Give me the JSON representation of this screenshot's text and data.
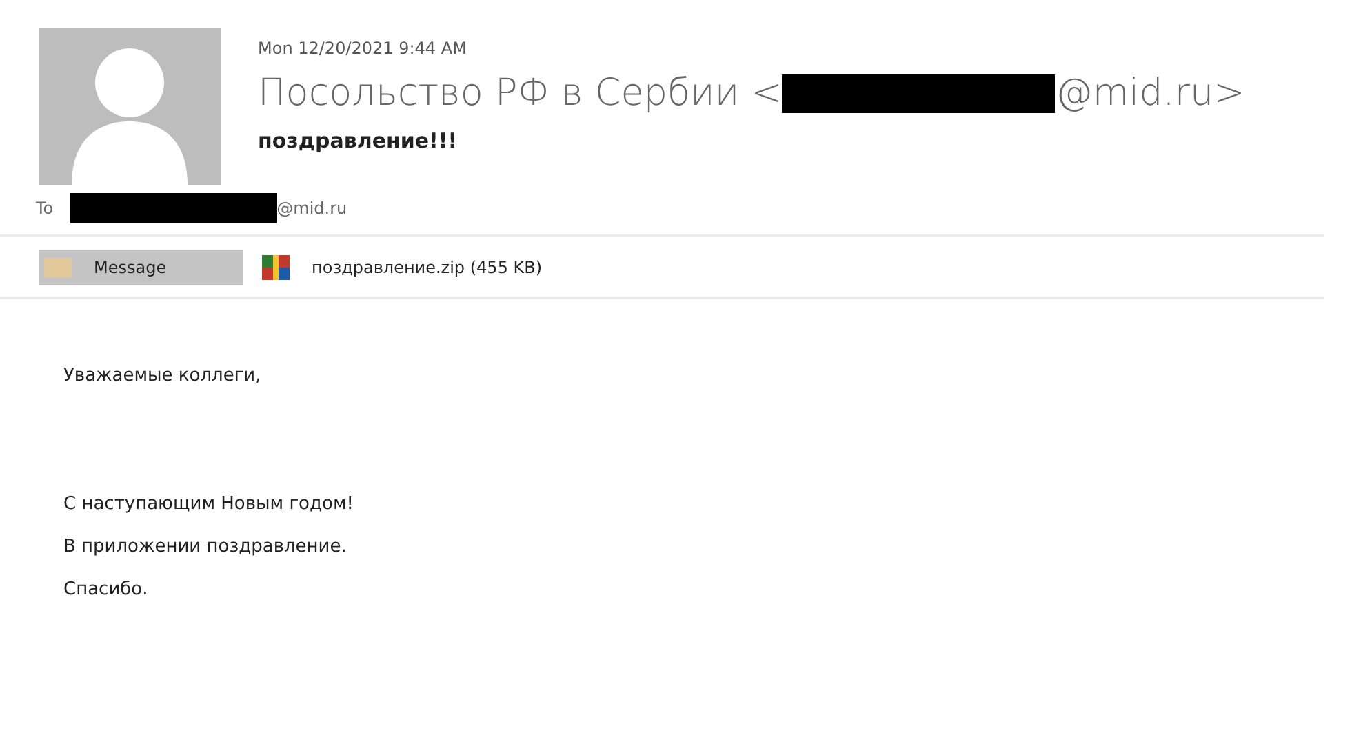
{
  "header": {
    "date": "Mon 12/20/2021 9:44 AM",
    "sender_before": "Посольство РФ в Сербии <",
    "sender_after": "@mid.ru>",
    "subject": "поздравление!!!",
    "to_label": "To",
    "to_after": "@mid.ru"
  },
  "tabs": [
    {
      "kind": "message",
      "label": "Message",
      "selected": true
    },
    {
      "kind": "attachment",
      "label": "поздравление.zip (455 KB)",
      "selected": false
    }
  ],
  "body": {
    "greeting": "Уважаемые коллеги,",
    "paragraphs": [
      "С наступающим Новым годом!",
      "В приложении поздравление.",
      "Спасибо."
    ]
  }
}
